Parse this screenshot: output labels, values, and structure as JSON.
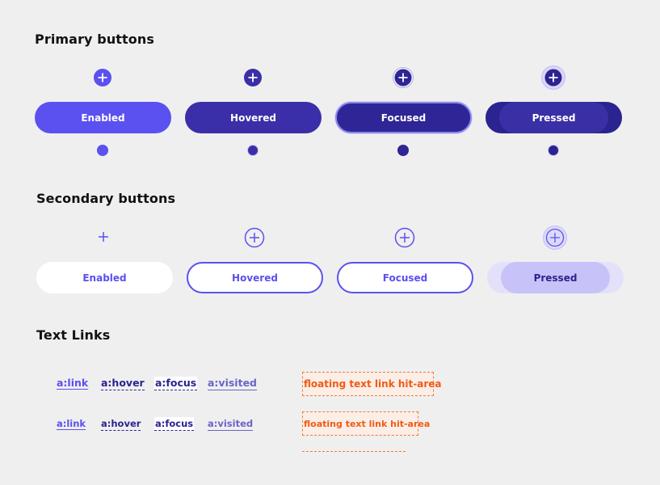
{
  "primary": {
    "heading": "Primary buttons",
    "buttons": [
      {
        "label": "Enabled"
      },
      {
        "label": "Hovered"
      },
      {
        "label": "Focused"
      },
      {
        "label": "Pressed"
      }
    ]
  },
  "secondary": {
    "heading": "Secondary buttons",
    "buttons": [
      {
        "label": "Enabled"
      },
      {
        "label": "Hovered"
      },
      {
        "label": "Focused"
      },
      {
        "label": "Pressed"
      }
    ]
  },
  "links": {
    "heading": "Text Links",
    "states": [
      "a:link",
      "a:hover",
      "a:focus",
      "a:visited"
    ],
    "hit_area_label": "floating text link hit-area"
  },
  "icons": {
    "add": "plus-circle-icon",
    "dot": "dot-icon"
  },
  "colors": {
    "primary": "#5b50f0",
    "primary_dark": "#2b2390",
    "hover": "#3a2fa8",
    "hit_area": "#f05a14",
    "background": "#efefef"
  }
}
